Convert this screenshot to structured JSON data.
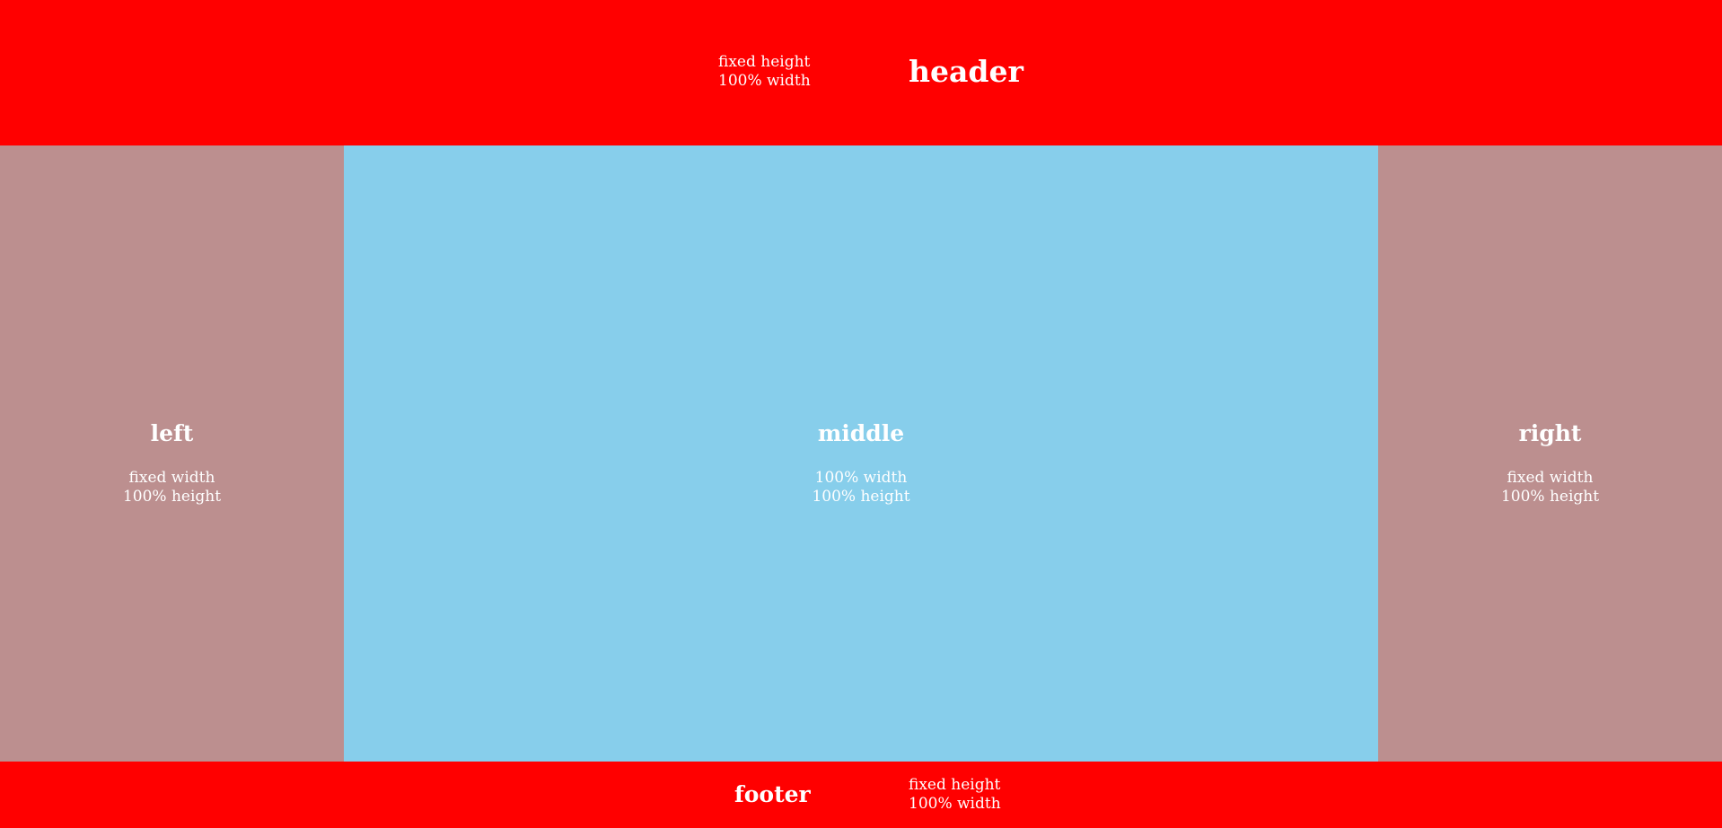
{
  "header": {
    "title": "header",
    "note_line1": "fixed height",
    "note_line2": "100% width",
    "color": "#ff0000"
  },
  "left": {
    "title": "left",
    "note_line1": "fixed width",
    "note_line2": "100% height",
    "color": "#bc8f8f"
  },
  "middle": {
    "title": "middle",
    "note_line1": "100% width",
    "note_line2": "100% height",
    "color": "#87ceeb"
  },
  "right": {
    "title": "right",
    "note_line1": "fixed width",
    "note_line2": "100% height",
    "color": "#bc8f8f"
  },
  "footer": {
    "title": "footer",
    "note_line1": "fixed height",
    "note_line2": "100% width",
    "color": "#ff0000"
  }
}
